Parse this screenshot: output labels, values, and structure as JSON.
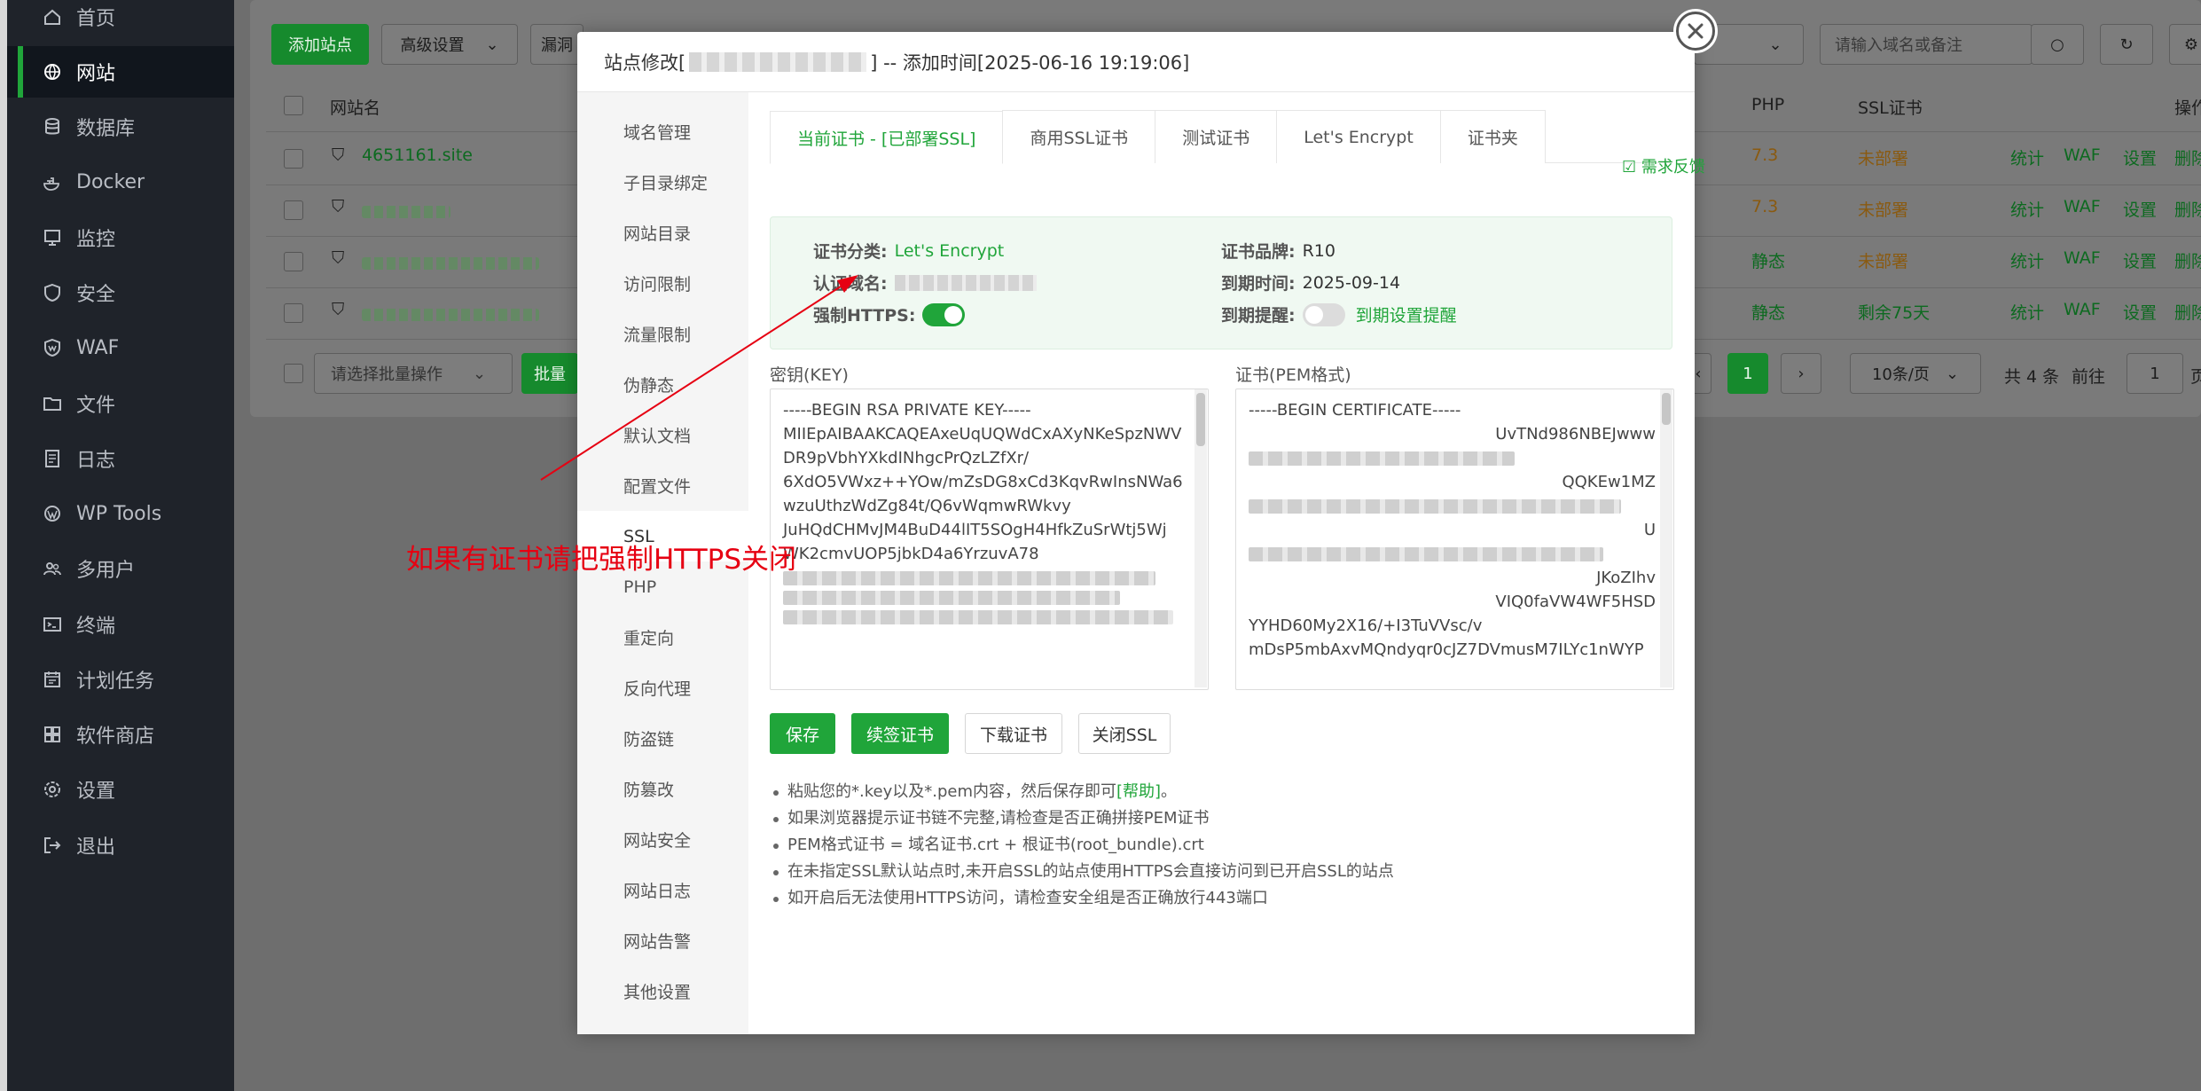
{
  "sidebar": {
    "items": [
      {
        "label": "首页",
        "icon": "home-icon"
      },
      {
        "label": "网站",
        "icon": "globe-icon",
        "active": true
      },
      {
        "label": "数据库",
        "icon": "database-icon"
      },
      {
        "label": "Docker",
        "icon": "docker-icon"
      },
      {
        "label": "监控",
        "icon": "monitor-icon"
      },
      {
        "label": "安全",
        "icon": "shield-icon"
      },
      {
        "label": "WAF",
        "icon": "waf-icon"
      },
      {
        "label": "文件",
        "icon": "folder-icon"
      },
      {
        "label": "日志",
        "icon": "log-icon"
      },
      {
        "label": "WP Tools",
        "icon": "wordpress-icon"
      },
      {
        "label": "多用户",
        "icon": "users-icon"
      },
      {
        "label": "终端",
        "icon": "terminal-icon"
      },
      {
        "label": "计划任务",
        "icon": "calendar-icon"
      },
      {
        "label": "软件商店",
        "icon": "apps-icon"
      },
      {
        "label": "设置",
        "icon": "gear-icon"
      },
      {
        "label": "退出",
        "icon": "logout-icon"
      }
    ]
  },
  "background": {
    "add_site": "添加站点",
    "advanced": "高级设置",
    "vuln": "漏洞",
    "search_placeholder": "请输入域名或备注",
    "col_site": "网站名",
    "col_php": "PHP",
    "col_ssl": "SSL证书",
    "col_ops": "操作",
    "first_site": "4651161.site",
    "rows": [
      {
        "php": "7.3",
        "ssl": "未部署"
      },
      {
        "php": "7.3",
        "ssl": "未部署"
      },
      {
        "php": "静态",
        "ssl": "未部署"
      },
      {
        "php": "静态",
        "ssl": "剩余75天"
      }
    ],
    "row_actions": [
      "统计",
      "WAF",
      "设置",
      "删除"
    ],
    "batch_placeholder": "请选择批量操作",
    "batch_btn": "批量",
    "page_current": "1",
    "page_size": "10条/页",
    "total": "共 4 条",
    "goto_label": "前往",
    "goto_value": "1",
    "page_suffix": "页"
  },
  "modal": {
    "title_prefix": "站点修改[",
    "title_suffix": "] -- 添加时间[2025-06-16 19:19:06]",
    "nav": [
      "域名管理",
      "子目录绑定",
      "网站目录",
      "访问限制",
      "流量限制",
      "伪静态",
      "默认文档",
      "配置文件",
      "SSL",
      "PHP",
      "重定向",
      "反向代理",
      "防盗链",
      "防篡改",
      "网站安全",
      "网站日志",
      "网站告警",
      "其他设置"
    ],
    "tabs": [
      "当前证书 - [已部署SSL]",
      "商用SSL证书",
      "测试证书",
      "Let's Encrypt",
      "证书夹"
    ],
    "feedback": "需求反馈",
    "cert": {
      "type_label": "证书分类:",
      "type_value": "Let's Encrypt",
      "domain_label": "认证域名:",
      "https_label": "强制HTTPS:",
      "brand_label": "证书品牌:",
      "brand_value": "R10",
      "expire_label": "到期时间:",
      "expire_value": "2025-09-14",
      "remind_label": "到期提醒:",
      "remind_link": "到期设置提醒"
    },
    "key_label": "密钥(KEY)",
    "pem_label": "证书(PEM格式)",
    "key_lines": [
      "-----BEGIN RSA PRIVATE KEY-----",
      "MIIEpAIBAAKCAQEAxeUqUQWdCxAXyNKeSpzNWV",
      "DR9pVbhYXkdINhgcPrQzLZfXr/",
      "6XdO5VWxz++YOw/mZsDG8xCd3KqvRwInsNWa6",
      "wzuUthzWdZg84t/Q6vWqmwRWkvy",
      "JuHQdCHMvJM4BuD44lIT5SOgH4HfkZuSrWtj5Wj",
      "WK2cmvUOP5jbkD4a6YrzuvA78"
    ],
    "pem_lines_top": [
      "-----BEGIN CERTIFICATE-----",
      "UvTNd986NBEJwww",
      "QQKEw1MZ",
      "U",
      "JKoZIhv"
    ],
    "pem_lines_bottom": [
      "VIQ0faVW4WF5HSD",
      "YYHD60My2X16/+I3TuVVsc/v",
      "mDsP5mbAxvMQndyqr0cJZ7DVmusM7ILYc1nWYP"
    ],
    "buttons": {
      "save": "保存",
      "renew": "续签证书",
      "download": "下载证书",
      "close_ssl": "关闭SSL"
    },
    "tips": [
      {
        "text": "粘贴您的*.key以及*.pem内容，然后保存即可",
        "link": "[帮助]",
        "end": "。"
      },
      {
        "text": "如果浏览器提示证书链不完整,请检查是否正确拼接PEM证书"
      },
      {
        "text": "PEM格式证书 = 域名证书.crt + 根证书(root_bundle).crt"
      },
      {
        "text": "在未指定SSL默认站点时,未开启SSL的站点使用HTTPS会直接访问到已开启SSL的站点"
      },
      {
        "text": "如开启后无法使用HTTPS访问，请检查安全组是否正确放行443端口"
      }
    ]
  },
  "annotation": {
    "text": "如果有证书请把强制HTTPS关闭",
    "color": "#e60012"
  },
  "colors": {
    "accent": "#20a53a",
    "sidebar_bg": "#1f232a"
  }
}
